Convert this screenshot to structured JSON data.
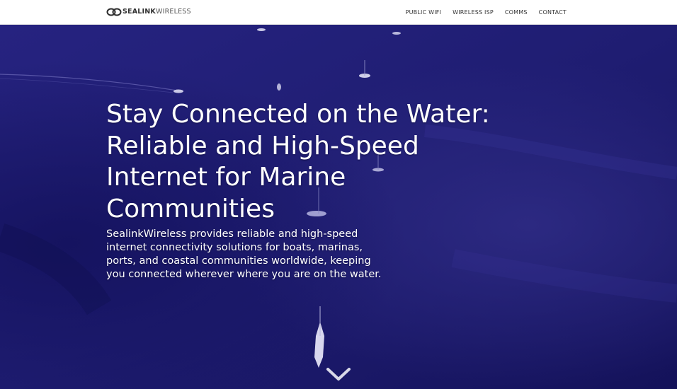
{
  "header": {
    "brand": {
      "part1": "SEALINK",
      "part2": "WIRELESS",
      "logo_icon": "linked-rings-logo"
    },
    "nav": [
      {
        "label": "PUBLIC WIFI"
      },
      {
        "label": "WIRELESS ISP"
      },
      {
        "label": "COMMS"
      },
      {
        "label": "CONTACT"
      }
    ]
  },
  "hero": {
    "title": "Stay Connected on the Water: Reliable and High-Speed Internet for Marine Communities",
    "description": "SealinkWireless provides reliable and high-speed internet connectivity solutions for boats, marinas, ports, and coastal communities worldwide, keeping you connected wherever where you are on the water.",
    "scroll_icon": "chevron-down-icon",
    "overlay_color": "#1e1c6e"
  }
}
